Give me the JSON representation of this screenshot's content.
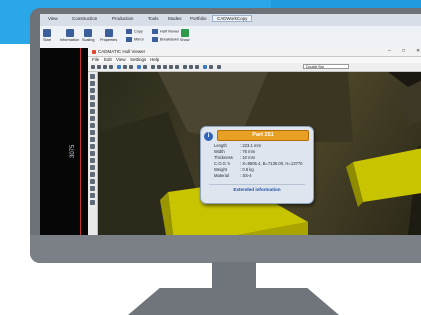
{
  "host_app": {
    "menu": [
      "View",
      "Construction",
      "Production",
      "Tools",
      "Modes",
      "Portfolio",
      "CADWork"
    ],
    "active_tab": "CADWorkCopy",
    "ribbon": {
      "big": [
        "Start",
        "Information",
        "Scaling",
        "Properties"
      ],
      "small": [
        "Copy",
        "Mirror",
        "Half Viewer",
        "Breakdown",
        "Show"
      ]
    },
    "left_dimension": "3075"
  },
  "viewer": {
    "title": "CADMATIC Hull Viewer",
    "window_controls": [
      "–",
      "□",
      "✕"
    ],
    "menu": [
      "File",
      "Edit",
      "View",
      "Settings",
      "Help"
    ],
    "combo_value": "Double Bar",
    "popup": {
      "header": "Part 251",
      "info_glyph": "i",
      "properties": [
        {
          "key": "Length",
          "value": ": 223.1 mm"
        },
        {
          "key": "Width",
          "value": ": 75 mm"
        },
        {
          "key": "Thickness",
          "value": ": 10 mm"
        },
        {
          "key": "C.O.G.'s",
          "value": ": X=9505.4, B=7130.00, H=13770"
        },
        {
          "key": "Weight",
          "value": ": 0.6 kg"
        },
        {
          "key": "Material",
          "value": ": SS-4"
        }
      ],
      "extended_link": "Extended information"
    }
  },
  "colors": {
    "accent_blue": "#2aa7e6",
    "popup_header": "#e7a024",
    "slab_yellow": "#c9c400",
    "monitor_gray": "#6c7277"
  }
}
